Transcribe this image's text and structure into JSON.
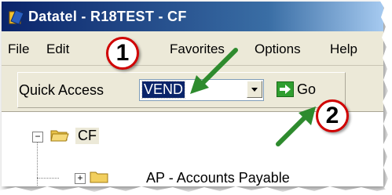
{
  "window": {
    "title": "Datatel - R18TEST - CF"
  },
  "menu": {
    "items": [
      "File",
      "Edit",
      "Favorites",
      "Options",
      "Help"
    ]
  },
  "toolbar": {
    "quick_access_label": "Quick Access",
    "quick_access_value": "VEND",
    "go_label": "Go"
  },
  "tree": {
    "root_label": "CF",
    "root_expander": "−",
    "children": [
      {
        "label": "AP - Accounts Payable",
        "expander": "+"
      }
    ]
  },
  "callouts": [
    "1",
    "2"
  ],
  "colors": {
    "callout_border": "#d00000",
    "arrow_green": "#2e8b2e",
    "titlebar_start": "#0a246a",
    "selection": "#0a246a"
  }
}
